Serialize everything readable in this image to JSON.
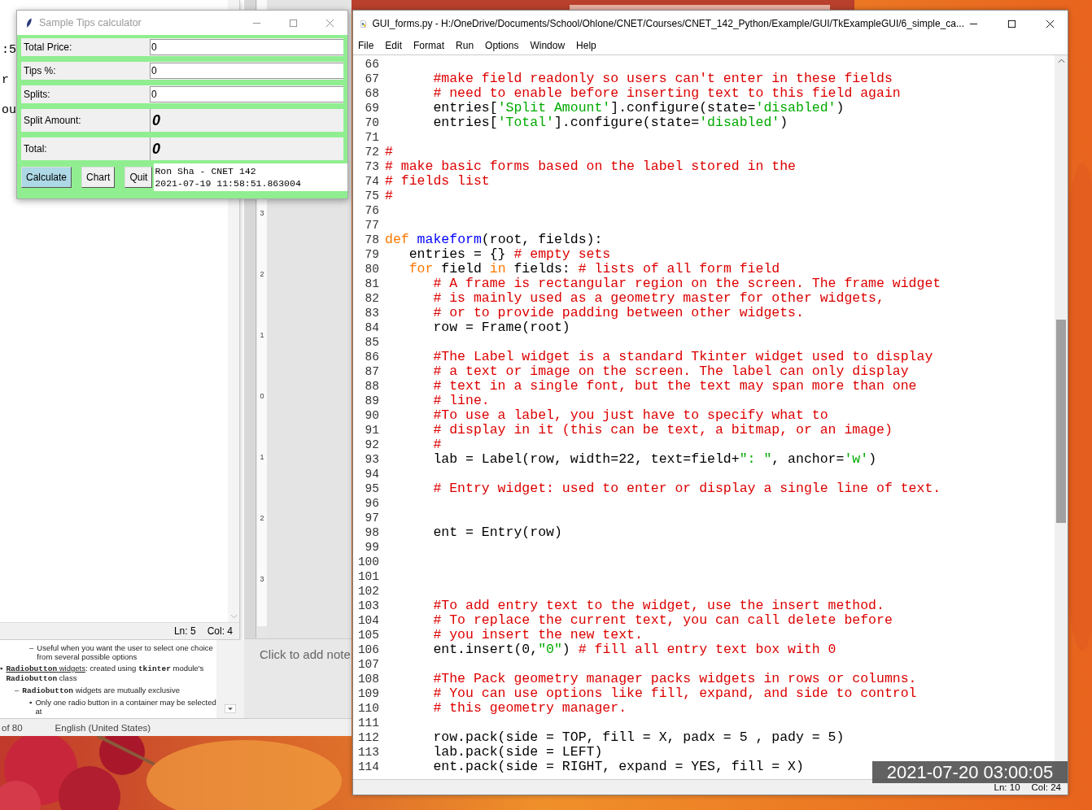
{
  "back_window": {
    "text_fragments": [
      ":5",
      "r",
      "ou"
    ],
    "status": {
      "line": "Ln: 5",
      "column": "Col: 4"
    },
    "ruler_marks": [
      "3",
      "2",
      "1",
      "0",
      "1",
      "2",
      "3"
    ],
    "notes_placeholder": "Click to add note",
    "outline_continuation": {
      "marker": "–",
      "segments": [
        {
          "kind": "text",
          "text": "Useful when you want the user to select one choice from several possible options"
        }
      ]
    },
    "outline": [
      {
        "marker": "▪",
        "segments": [
          {
            "kind": "mono",
            "text": "Radiobutton",
            "underline": true
          },
          {
            "kind": "text",
            "text": " widgets",
            "underline": true
          },
          {
            "kind": "text",
            "text": ": created using "
          },
          {
            "kind": "mono",
            "text": "tkinter"
          },
          {
            "kind": "text",
            "text": " module's "
          },
          {
            "kind": "mono",
            "text": "Radiobutton"
          },
          {
            "kind": "text",
            "text": " class"
          }
        ],
        "children": [
          {
            "marker": "–",
            "segments": [
              {
                "kind": "mono",
                "text": "Radiobutton"
              },
              {
                "kind": "text",
                "text": " widgets are mutually exclusive"
              }
            ],
            "children": [
              {
                "marker": "▪",
                "segments": [
                  {
                    "kind": "text",
                    "text": "Only one radio button in a container may be selected at"
                  }
                ]
              }
            ]
          }
        ]
      }
    ],
    "status_bar": {
      "slide": "of 80",
      "language": "English (United States)"
    }
  },
  "tk_window": {
    "title": "Sample Tips calculator",
    "fields": [
      {
        "label": "Total Price:",
        "value": "0",
        "kind": "entry"
      },
      {
        "label": "Tips %:",
        "value": "0",
        "kind": "entry"
      },
      {
        "label": "Splits:",
        "value": "0",
        "kind": "entry"
      },
      {
        "label": "Split Amount:",
        "value": "0",
        "kind": "readonly"
      },
      {
        "label": "Total:",
        "value": "0",
        "kind": "readonly"
      }
    ],
    "buttons": [
      {
        "label": "Calculate",
        "focused": true
      },
      {
        "label": "Chart",
        "focused": false
      },
      {
        "label": "Quit",
        "focused": false
      }
    ],
    "info_lines": [
      "Ron Sha - CNET 142",
      "2021-07-19 11:58:51.863004"
    ]
  },
  "editor": {
    "title": "GUI_forms.py - H:/OneDrive/Documents/School/Ohlone/CNET/Courses/CNET_142_Python/Example/GUI/TkExampleGUI/6_simple_ca...",
    "menu": [
      "File",
      "Edit",
      "Format",
      "Run",
      "Options",
      "Window",
      "Help"
    ],
    "lines": [
      {
        "number": "66"
      },
      {
        "number": "67",
        "tokens": [
          {
            "kind": "comment",
            "text": "      #make field readonly so users can't enter in these fields"
          }
        ]
      },
      {
        "number": "68",
        "tokens": [
          {
            "kind": "comment",
            "text": "      # need to enable before inserting text to this field again"
          }
        ]
      },
      {
        "number": "69",
        "tokens": [
          {
            "kind": "code",
            "text": "      entries["
          },
          {
            "kind": "string",
            "text": "'Split Amount'"
          },
          {
            "kind": "code",
            "text": "].configure(state="
          },
          {
            "kind": "string",
            "text": "'disabled'"
          },
          {
            "kind": "code",
            "text": ")"
          }
        ]
      },
      {
        "number": "70",
        "tokens": [
          {
            "kind": "code",
            "text": "      entries["
          },
          {
            "kind": "string",
            "text": "'Total'"
          },
          {
            "kind": "code",
            "text": "].configure(state="
          },
          {
            "kind": "string",
            "text": "'disabled'"
          },
          {
            "kind": "code",
            "text": ")"
          }
        ]
      },
      {
        "number": "71"
      },
      {
        "number": "72",
        "tokens": [
          {
            "kind": "comment",
            "text": "#"
          }
        ]
      },
      {
        "number": "73",
        "tokens": [
          {
            "kind": "comment",
            "text": "# make basic forms based on the label stored in the"
          }
        ]
      },
      {
        "number": "74",
        "tokens": [
          {
            "kind": "comment",
            "text": "# fields list"
          }
        ]
      },
      {
        "number": "75",
        "tokens": [
          {
            "kind": "comment",
            "text": "#"
          }
        ]
      },
      {
        "number": "76"
      },
      {
        "number": "77"
      },
      {
        "number": "78",
        "tokens": [
          {
            "kind": "keyword",
            "text": "def"
          },
          {
            "kind": "defname",
            "text": " makeform"
          },
          {
            "kind": "code",
            "text": "(root, fields):"
          }
        ]
      },
      {
        "number": "79",
        "tokens": [
          {
            "kind": "code",
            "text": "   entries = {} "
          },
          {
            "kind": "comment",
            "text": "# empty sets"
          }
        ]
      },
      {
        "number": "80",
        "tokens": [
          {
            "kind": "keyword",
            "text": "   for"
          },
          {
            "kind": "code",
            "text": " field "
          },
          {
            "kind": "keyword",
            "text": "in"
          },
          {
            "kind": "code",
            "text": " fields: "
          },
          {
            "kind": "comment",
            "text": "# lists of all form field"
          }
        ]
      },
      {
        "number": "81",
        "tokens": [
          {
            "kind": "comment",
            "text": "      # A frame is rectangular region on the screen. The frame widget"
          }
        ]
      },
      {
        "number": "82",
        "tokens": [
          {
            "kind": "comment",
            "text": "      # is mainly used as a geometry master for other widgets,"
          }
        ]
      },
      {
        "number": "83",
        "tokens": [
          {
            "kind": "comment",
            "text": "      # or to provide padding between other widgets."
          }
        ]
      },
      {
        "number": "84",
        "tokens": [
          {
            "kind": "code",
            "text": "      row = Frame(root)"
          }
        ]
      },
      {
        "number": "85"
      },
      {
        "number": "86",
        "tokens": [
          {
            "kind": "comment",
            "text": "      #The Label widget is a standard Tkinter widget used to display"
          }
        ]
      },
      {
        "number": "87",
        "tokens": [
          {
            "kind": "comment",
            "text": "      # a text or image on the screen. The label can only display"
          }
        ]
      },
      {
        "number": "88",
        "tokens": [
          {
            "kind": "comment",
            "text": "      # text in a single font, but the text may span more than one"
          }
        ]
      },
      {
        "number": "89",
        "tokens": [
          {
            "kind": "comment",
            "text": "      # line."
          }
        ]
      },
      {
        "number": "90",
        "tokens": [
          {
            "kind": "comment",
            "text": "      #To use a label, you just have to specify what to"
          }
        ]
      },
      {
        "number": "91",
        "tokens": [
          {
            "kind": "comment",
            "text": "      # display in it (this can be text, a bitmap, or an image)"
          }
        ]
      },
      {
        "number": "92",
        "tokens": [
          {
            "kind": "comment",
            "text": "      #"
          }
        ]
      },
      {
        "number": "93",
        "tokens": [
          {
            "kind": "code",
            "text": "      lab = Label(row, width=22, text=field+"
          },
          {
            "kind": "string",
            "text": "\": \""
          },
          {
            "kind": "code",
            "text": ", anchor="
          },
          {
            "kind": "string",
            "text": "'w'"
          },
          {
            "kind": "code",
            "text": ")"
          }
        ]
      },
      {
        "number": "94"
      },
      {
        "number": "95",
        "tokens": [
          {
            "kind": "comment",
            "text": "      # Entry widget: used to enter or display a single line of text."
          }
        ]
      },
      {
        "number": "96"
      },
      {
        "number": "97"
      },
      {
        "number": "98",
        "tokens": [
          {
            "kind": "code",
            "text": "      ent = Entry(row)"
          }
        ]
      },
      {
        "number": "99"
      },
      {
        "number": "100"
      },
      {
        "number": "101"
      },
      {
        "number": "102"
      },
      {
        "number": "103",
        "tokens": [
          {
            "kind": "comment",
            "text": "      #To add entry text to the widget, use the insert method."
          }
        ]
      },
      {
        "number": "104",
        "tokens": [
          {
            "kind": "comment",
            "text": "      # To replace the current text, you can call delete before"
          }
        ]
      },
      {
        "number": "105",
        "tokens": [
          {
            "kind": "comment",
            "text": "      # you insert the new text."
          }
        ]
      },
      {
        "number": "106",
        "tokens": [
          {
            "kind": "code",
            "text": "      ent.insert(0,"
          },
          {
            "kind": "string",
            "text": "\"0\""
          },
          {
            "kind": "code",
            "text": ") "
          },
          {
            "kind": "comment",
            "text": "# fill all entry text box with 0"
          }
        ]
      },
      {
        "number": "107"
      },
      {
        "number": "108",
        "tokens": [
          {
            "kind": "comment",
            "text": "      #The Pack geometry manager packs widgets in rows or columns."
          }
        ]
      },
      {
        "number": "109",
        "tokens": [
          {
            "kind": "comment",
            "text": "      # You can use options like fill, expand, and side to control"
          }
        ]
      },
      {
        "number": "110",
        "tokens": [
          {
            "kind": "comment",
            "text": "      # this geometry manager."
          }
        ]
      },
      {
        "number": "111"
      },
      {
        "number": "112",
        "tokens": [
          {
            "kind": "code",
            "text": "      row.pack(side = TOP, fill = X, padx = 5 , pady = 5)"
          }
        ]
      },
      {
        "number": "113",
        "tokens": [
          {
            "kind": "code",
            "text": "      lab.pack(side = LEFT)"
          }
        ]
      },
      {
        "number": "114",
        "tokens": [
          {
            "kind": "code",
            "text": "      ent.pack(side = RIGHT, expand = YES, fill = X)"
          }
        ]
      }
    ],
    "status": {
      "line": "Ln: 10",
      "column": "Col: 24"
    }
  },
  "overlay_timestamp": "2021-07-20 03:00:05"
}
